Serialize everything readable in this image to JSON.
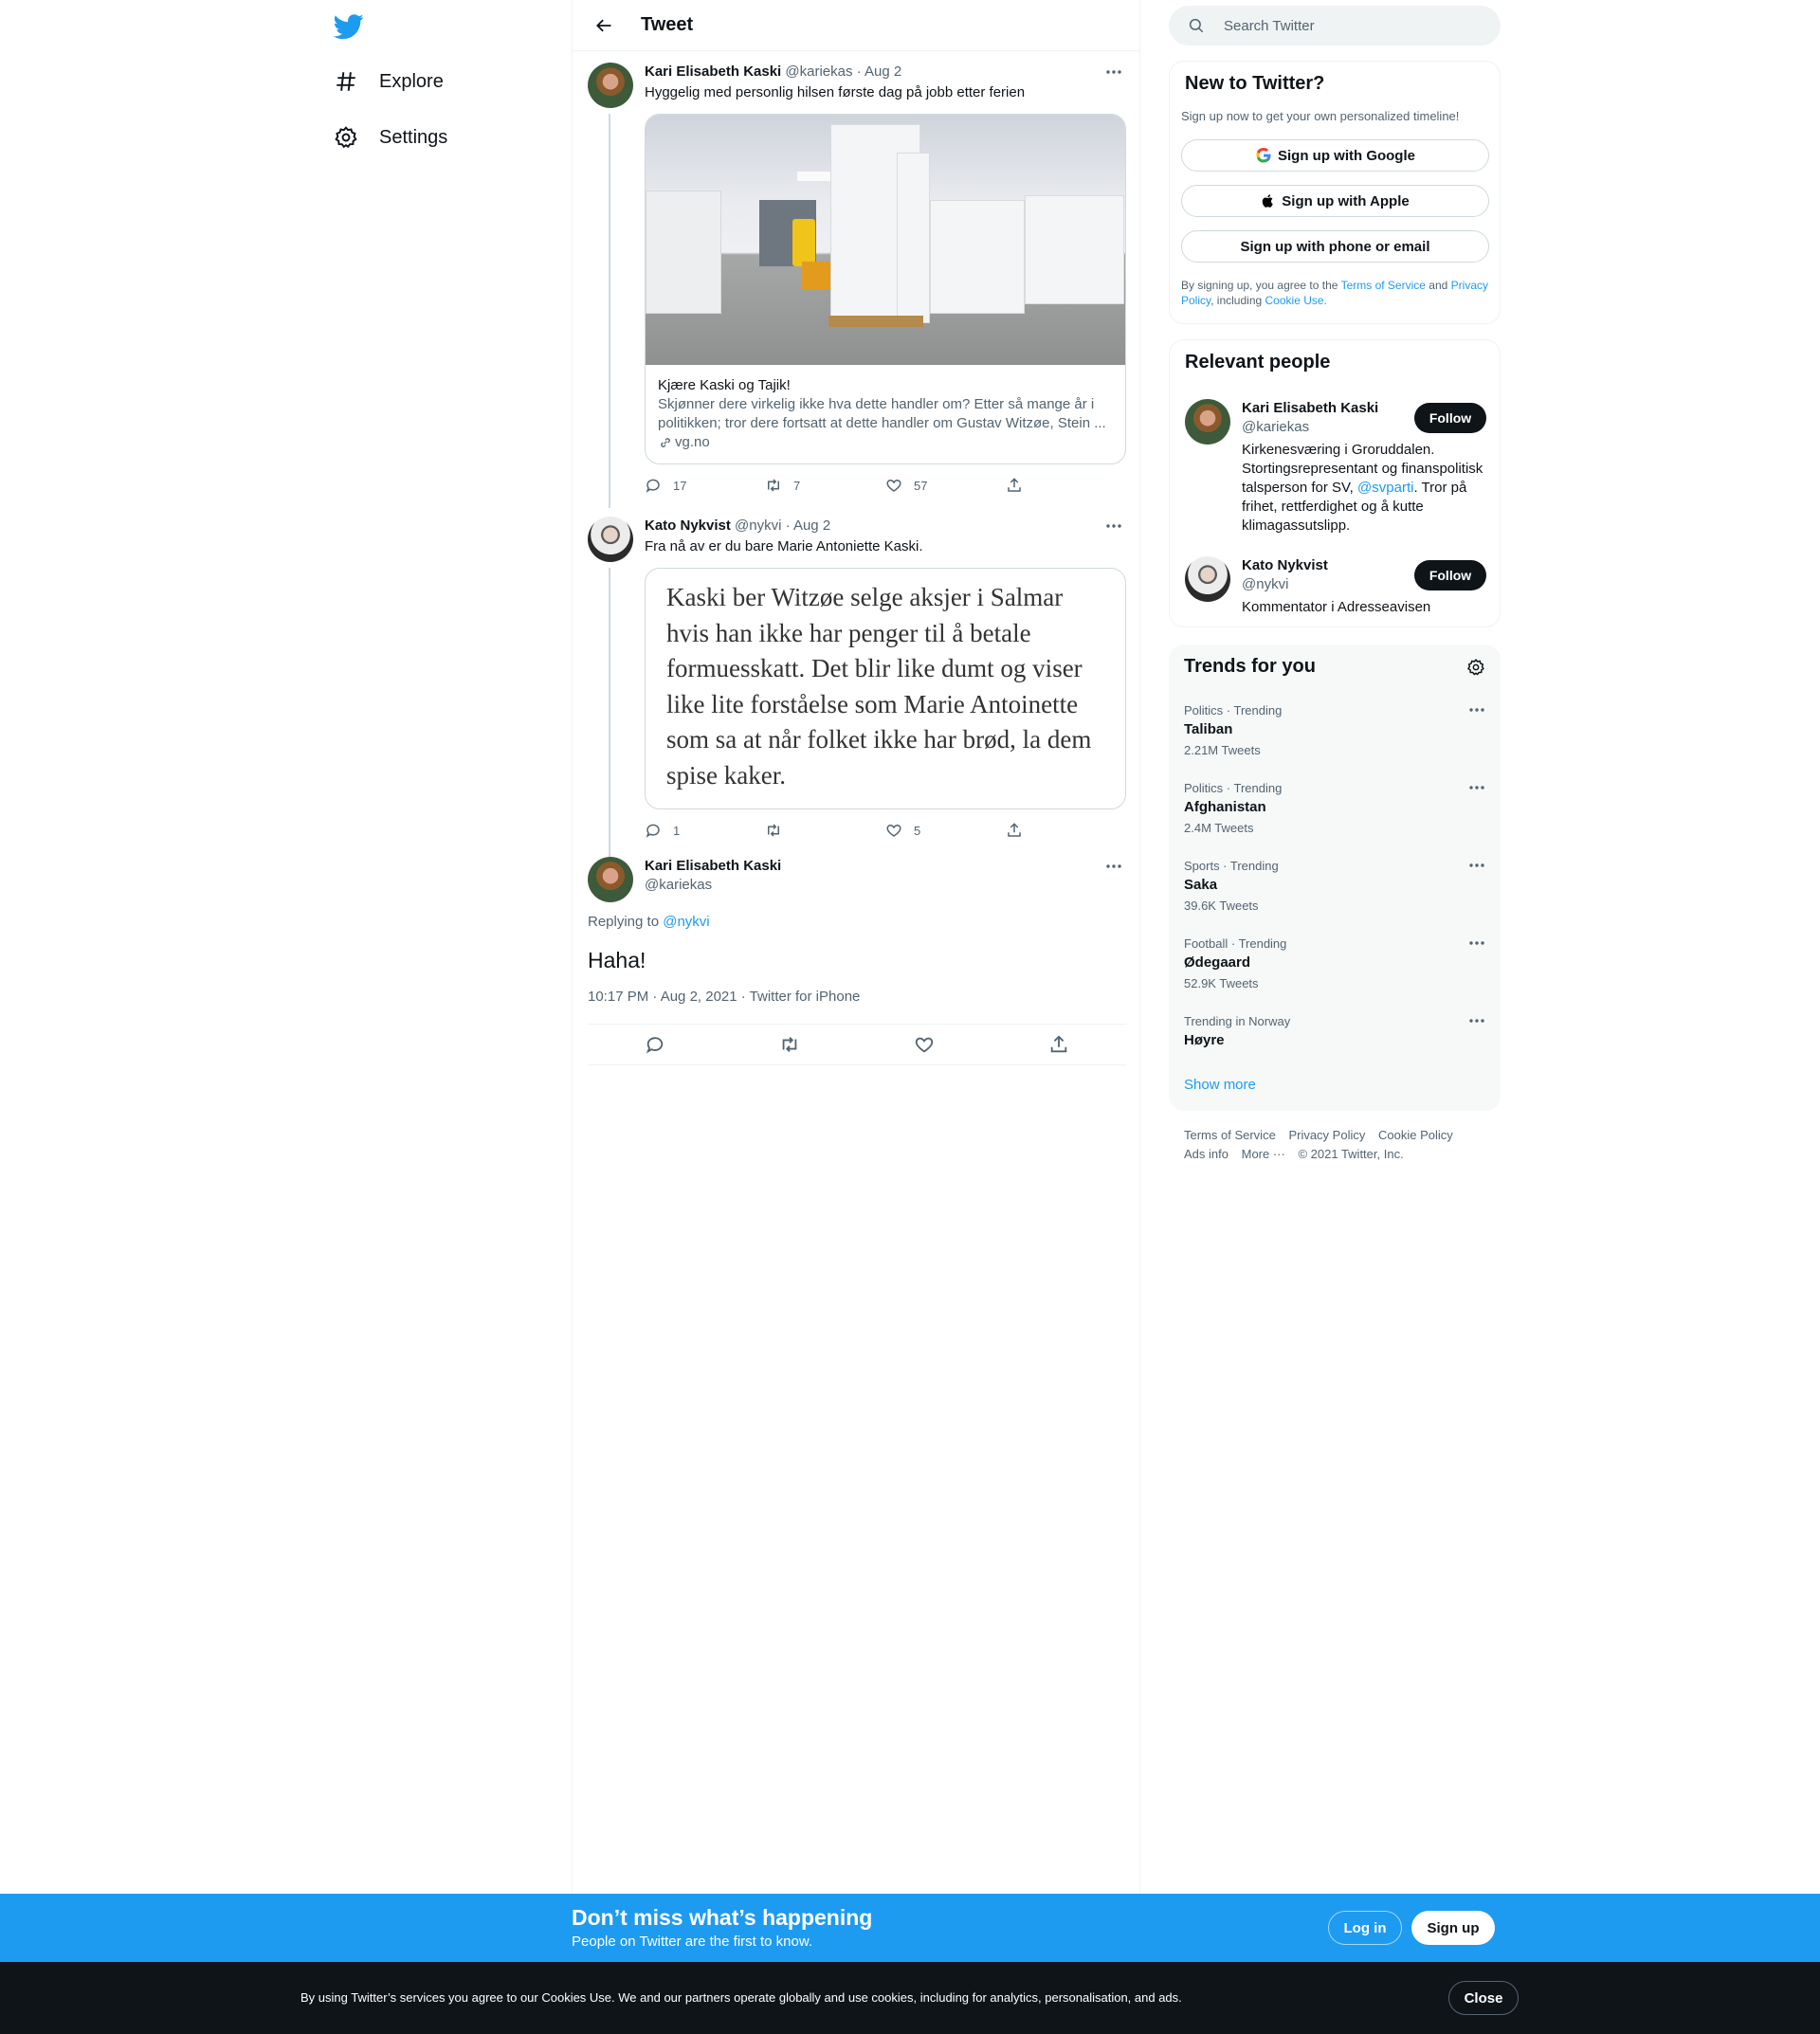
{
  "nav": {
    "explore_label": "Explore",
    "settings_label": "Settings"
  },
  "header": {
    "title": "Tweet"
  },
  "tweet1": {
    "name": "Kari Elisabeth Kaski",
    "handle": "@kariekas",
    "date": "· Aug 2",
    "text": "Hyggelig med personlig hilsen første dag på jobb etter ferien",
    "card_title": "Kjære Kaski og Tajik!",
    "card_desc": "Skjønner dere virkelig ikke hva dette handler om? Etter så mange år i politikken; tror dere fortsatt at dette handler om Gustav Witzøe, Stein ...",
    "card_domain": "vg.no",
    "replies": "17",
    "retweets": "7",
    "likes": "57"
  },
  "tweet2": {
    "name": "Kato Nykvist",
    "handle": "@nykvi",
    "date": "· Aug 2",
    "text": "Fra nå av er du bare Marie Antoniette Kaski.",
    "quote_text": "Kaski ber Witzøe selge aksjer i Salmar hvis han ikke har penger til å betale formuesskatt. Det blir like dumt og viser like lite forståelse som Marie Antoinette som sa at når folket ikke har brød, la dem spise kaker.",
    "replies": "1",
    "retweets": "",
    "likes": "5"
  },
  "tweet3": {
    "name": "Kari Elisabeth Kaski",
    "handle": "@kariekas",
    "replying_prefix": "Replying to",
    "replying_to": "@nykvi",
    "text": "Haha!",
    "meta": "10:17 PM · Aug 2, 2021 · Twitter for iPhone"
  },
  "search": {
    "placeholder": "Search Twitter"
  },
  "new_to_twitter": {
    "title": "New to Twitter?",
    "subtitle": "Sign up now to get your own personalized timeline!",
    "google_label": "Sign up with Google",
    "apple_label": "Sign up with Apple",
    "phone_label": "Sign up with phone or email",
    "legal_1": "By signing up, you agree to the",
    "tos": "Terms of Service",
    "legal_2": "and",
    "privacy": "Privacy Policy",
    "legal_3": ", including",
    "cookie_use": "Cookie Use."
  },
  "relevant": {
    "title": "Relevant people",
    "people": [
      {
        "name": "Kari Elisabeth Kaski",
        "handle": "@kariekas",
        "bio_1": "Kirkenesværing i Groruddalen. Stortingsrepresentant og finanspolitisk talsperson for SV,",
        "bio_link": "@svparti",
        "bio_2": ". Tror på frihet, rettferdighet og å kutte klimagassutslipp.",
        "follow_label": "Follow"
      },
      {
        "name": "Kato Nykvist",
        "handle": "@nykvi",
        "bio_1": "Kommentator i Adresseavisen",
        "follow_label": "Follow"
      }
    ]
  },
  "trends": {
    "title": "Trends for you",
    "items": [
      {
        "category": "Politics · Trending",
        "name": "Taliban",
        "count": "2.21M Tweets"
      },
      {
        "category": "Politics · Trending",
        "name": "Afghanistan",
        "count": "2.4M Tweets"
      },
      {
        "category": "Sports · Trending",
        "name": "Saka",
        "count": "39.6K Tweets"
      },
      {
        "category": "Football · Trending",
        "name": "Ødegaard",
        "count": "52.9K Tweets"
      },
      {
        "category": "Trending in Norway",
        "name": "Høyre",
        "count": ""
      }
    ],
    "show_more": "Show more"
  },
  "footer": {
    "tos": "Terms of Service",
    "privacy": "Privacy Policy",
    "cookie": "Cookie Policy",
    "ads": "Ads info",
    "more": "More ···",
    "copyright": "© 2021 Twitter, Inc."
  },
  "bottom_bar": {
    "headline": "Don’t miss what’s happening",
    "sub": "People on Twitter are the first to know.",
    "login_label": "Log in",
    "signup_label": "Sign up"
  },
  "cookie_bar": {
    "text": "By using Twitter’s services you agree to our Cookies Use. We and our partners operate globally and use cookies, including for analytics, personalisation, and ads.",
    "close_label": "Close"
  },
  "colors": {
    "accent": "#1d9bf0",
    "text": "#0f1419",
    "muted": "#536471"
  }
}
